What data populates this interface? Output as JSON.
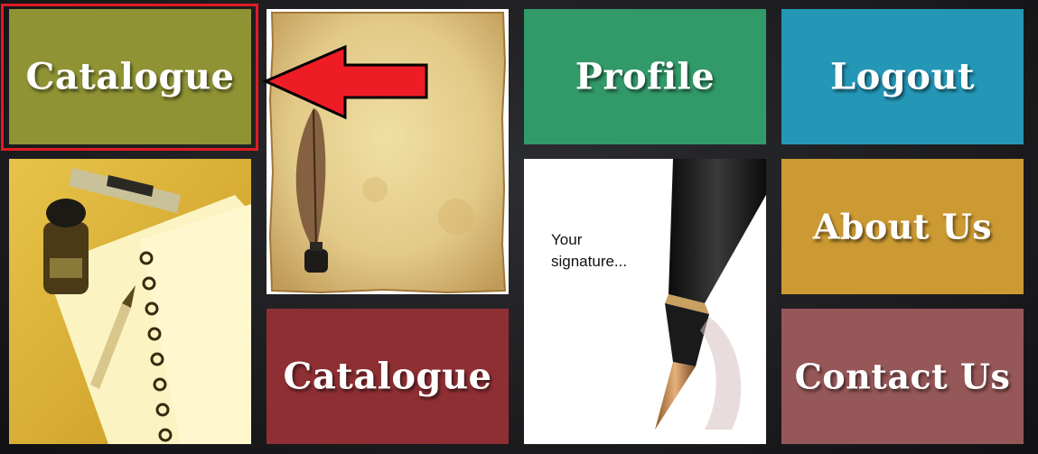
{
  "tiles": {
    "catalogue_top": {
      "label": "Catalogue",
      "color": "#8f9334"
    },
    "profile": {
      "label": "Profile",
      "color": "#329a69"
    },
    "logout": {
      "label": "Logout",
      "color": "#2497b7"
    },
    "about": {
      "label": "About Us",
      "color": "#cc9a32"
    },
    "catalogue_bottom": {
      "label": "Catalogue",
      "color": "#8e2f34"
    },
    "contact": {
      "label": "Contact Us",
      "color": "#965758"
    }
  },
  "signature_image": {
    "line1": "Your",
    "line2": "signature..."
  },
  "annotation": {
    "frame_color": "#e01b24",
    "arrow_color": "#ee1c25"
  }
}
